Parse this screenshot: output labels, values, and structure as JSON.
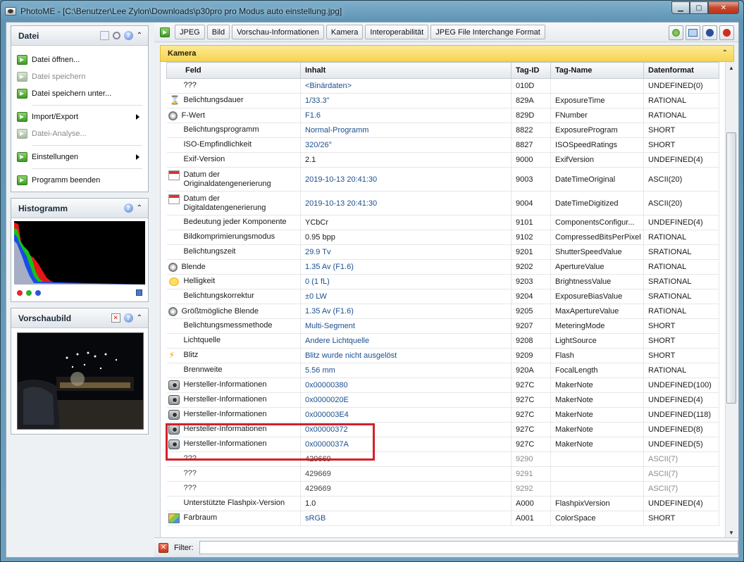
{
  "window": {
    "title": "PhotoME - [C:\\Benutzer\\Lee Zylon\\Downloads\\p30pro pro Modus auto einstellung.jpg]"
  },
  "left": {
    "datei": {
      "title": "Datei",
      "items": [
        {
          "label": "Datei öffnen...",
          "disabled": false
        },
        {
          "label": "Datei speichern",
          "disabled": true
        },
        {
          "label": "Datei speichern unter...",
          "disabled": false
        },
        {
          "label": "Import/Export",
          "disabled": false
        },
        {
          "label": "Datei-Analyse...",
          "disabled": true
        },
        {
          "label": "Einstellungen",
          "disabled": false
        },
        {
          "label": "Programm beenden",
          "disabled": false
        }
      ]
    },
    "histogramm": {
      "title": "Histogramm"
    },
    "vorschau": {
      "title": "Vorschaubild"
    }
  },
  "tabs": [
    "JPEG",
    "Bild",
    "Vorschau-Informationen",
    "Kamera",
    "Interoperabilität",
    "JPEG File Interchange Format"
  ],
  "section": {
    "title": "Kamera"
  },
  "table": {
    "headers": [
      "Feld",
      "Inhalt",
      "Tag-ID",
      "Tag-Name",
      "Datenformat"
    ],
    "rows": [
      {
        "icon": "none",
        "feld": "???",
        "inhalt": "<Binärdaten>",
        "tag": "010D",
        "name": "",
        "fmt": "UNDEFINED(0)"
      },
      {
        "icon": "hourglass",
        "feld": "Belichtungsdauer",
        "inhalt": "1/33.3\"",
        "tag": "829A",
        "name": "ExposureTime",
        "fmt": "RATIONAL"
      },
      {
        "icon": "aperture",
        "feld": "F-Wert",
        "inhalt": "F1.6",
        "tag": "829D",
        "name": "FNumber",
        "fmt": "RATIONAL"
      },
      {
        "icon": "none",
        "feld": "Belichtungsprogramm",
        "inhalt": "Normal-Programm",
        "tag": "8822",
        "name": "ExposureProgram",
        "fmt": "SHORT"
      },
      {
        "icon": "none",
        "feld": "ISO-Empfindlichkeit",
        "inhalt": "320/26°",
        "tag": "8827",
        "name": "ISOSpeedRatings",
        "fmt": "SHORT"
      },
      {
        "icon": "none",
        "feld": "Exif-Version",
        "inhalt": "2.1",
        "tag": "9000",
        "name": "ExifVersion",
        "fmt": "UNDEFINED(4)",
        "plain": true
      },
      {
        "icon": "calendar",
        "feld": "Datum der Originaldatengenerierung",
        "inhalt": "2019-10-13 20:41:30",
        "tag": "9003",
        "name": "DateTimeOriginal",
        "fmt": "ASCII(20)",
        "tall": true
      },
      {
        "icon": "calendar",
        "feld": "Datum der Digitaldatengenerierung",
        "inhalt": "2019-10-13 20:41:30",
        "tag": "9004",
        "name": "DateTimeDigitized",
        "fmt": "ASCII(20)",
        "tall": true
      },
      {
        "icon": "none",
        "feld": "Bedeutung jeder Komponente",
        "inhalt": "YCbCr",
        "tag": "9101",
        "name": "ComponentsConfigur...",
        "fmt": "UNDEFINED(4)",
        "plain": true
      },
      {
        "icon": "none",
        "feld": "Bildkomprimierungsmodus",
        "inhalt": "0.95 bpp",
        "tag": "9102",
        "name": "CompressedBitsPerPixel",
        "fmt": "RATIONAL",
        "plain": true
      },
      {
        "icon": "none",
        "feld": "Belichtungszeit",
        "inhalt": "29.9 Tv",
        "tag": "9201",
        "name": "ShutterSpeedValue",
        "fmt": "SRATIONAL"
      },
      {
        "icon": "aperture",
        "feld": "Blende",
        "inhalt": "1.35 Av (F1.6)",
        "tag": "9202",
        "name": "ApertureValue",
        "fmt": "RATIONAL"
      },
      {
        "icon": "sun",
        "feld": "Helligkeit",
        "inhalt": "0 (1 fL)",
        "tag": "9203",
        "name": "BrightnessValue",
        "fmt": "SRATIONAL"
      },
      {
        "icon": "none",
        "feld": "Belichtungskorrektur",
        "inhalt": "±0 LW",
        "tag": "9204",
        "name": "ExposureBiasValue",
        "fmt": "SRATIONAL"
      },
      {
        "icon": "aperture",
        "feld": "Größtmögliche Blende",
        "inhalt": "1.35 Av (F1.6)",
        "tag": "9205",
        "name": "MaxApertureValue",
        "fmt": "RATIONAL"
      },
      {
        "icon": "none",
        "feld": "Belichtungsmessmethode",
        "inhalt": "Multi-Segment",
        "tag": "9207",
        "name": "MeteringMode",
        "fmt": "SHORT"
      },
      {
        "icon": "none",
        "feld": "Lichtquelle",
        "inhalt": "Andere Lichtquelle",
        "tag": "9208",
        "name": "LightSource",
        "fmt": "SHORT"
      },
      {
        "icon": "flash",
        "feld": "Blitz",
        "inhalt": "Blitz wurde nicht ausgelöst",
        "tag": "9209",
        "name": "Flash",
        "fmt": "SHORT"
      },
      {
        "icon": "none",
        "feld": "Brennweite",
        "inhalt": "5.56 mm",
        "tag": "920A",
        "name": "FocalLength",
        "fmt": "RATIONAL"
      },
      {
        "icon": "camera",
        "feld": "Hersteller-Informationen",
        "inhalt": "0x00000380",
        "tag": "927C",
        "name": "MakerNote",
        "fmt": "UNDEFINED(100)"
      },
      {
        "icon": "camera",
        "feld": "Hersteller-Informationen",
        "inhalt": "0x0000020E",
        "tag": "927C",
        "name": "MakerNote",
        "fmt": "UNDEFINED(4)"
      },
      {
        "icon": "camera",
        "feld": "Hersteller-Informationen",
        "inhalt": "0x000003E4",
        "tag": "927C",
        "name": "MakerNote",
        "fmt": "UNDEFINED(118)"
      },
      {
        "icon": "camera",
        "feld": "Hersteller-Informationen",
        "inhalt": "0x00000372",
        "tag": "927C",
        "name": "MakerNote",
        "fmt": "UNDEFINED(8)"
      },
      {
        "icon": "camera",
        "feld": "Hersteller-Informationen",
        "inhalt": "0x0000037A",
        "tag": "927C",
        "name": "MakerNote",
        "fmt": "UNDEFINED(5)"
      },
      {
        "icon": "none",
        "feld": "???",
        "inhalt": "429669",
        "tag": "9290",
        "name": "",
        "fmt": "ASCII(7)",
        "gray": true
      },
      {
        "icon": "none",
        "feld": "???",
        "inhalt": "429669",
        "tag": "9291",
        "name": "",
        "fmt": "ASCII(7)",
        "gray": true
      },
      {
        "icon": "none",
        "feld": "???",
        "inhalt": "429669",
        "tag": "9292",
        "name": "",
        "fmt": "ASCII(7)",
        "gray": true
      },
      {
        "icon": "none",
        "feld": "Unterstützte Flashpix-Version",
        "inhalt": "1.0",
        "tag": "A000",
        "name": "FlashpixVersion",
        "fmt": "UNDEFINED(4)",
        "plain": true
      },
      {
        "icon": "cube",
        "feld": "Farbraum",
        "inhalt": "sRGB",
        "tag": "A001",
        "name": "ColorSpace",
        "fmt": "SHORT"
      }
    ]
  },
  "filter": {
    "label": "Filter:",
    "value": ""
  },
  "colors": {
    "accent_yellow": "#f6d553",
    "highlight_red": "#d42027",
    "link_blue": "#1b4f8f"
  }
}
